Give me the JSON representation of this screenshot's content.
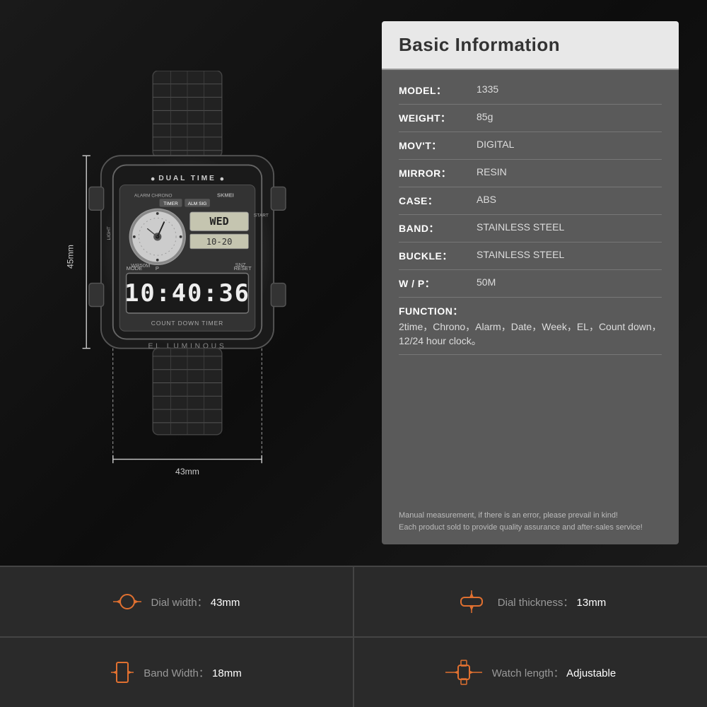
{
  "header": {
    "title": "Basic Information"
  },
  "specs_info": [
    {
      "key": "MODEL",
      "label": "MODEL：",
      "value": "1335"
    },
    {
      "key": "WEIGHT",
      "label": "WEIGHT：",
      "value": "85g"
    },
    {
      "key": "MOVT",
      "label": "MOV'T：",
      "value": "DIGITAL"
    },
    {
      "key": "MIRROR",
      "label": "MIRROR：",
      "value": "RESIN"
    },
    {
      "key": "CASE",
      "label": "CASE：",
      "value": "ABS"
    },
    {
      "key": "BAND",
      "label": "BAND：",
      "value": "STAINLESS STEEL"
    },
    {
      "key": "BUCKLE",
      "label": "BUCKLE：",
      "value": "STAINLESS STEEL"
    },
    {
      "key": "WP",
      "label": "W / P：",
      "value": "50M"
    }
  ],
  "function": {
    "label": "FUNCTION：",
    "value": "2time，Chrono，Alarm，Date，Week，EL，Count down，12/24 hour clock。"
  },
  "disclaimer": "Manual measurement, if there is an error, please prevail in kind!\nEach product sold to provide quality assurance and after-sales service!",
  "dimensions": {
    "height": "45mm",
    "width": "43mm"
  },
  "bottom_specs": [
    {
      "icon": "dial-width",
      "label": "Dial width：",
      "value": "43mm"
    },
    {
      "icon": "dial-thickness",
      "label": "Dial thickness：",
      "value": "13mm"
    },
    {
      "icon": "band-width",
      "label": "Band Width：",
      "value": "18mm"
    },
    {
      "icon": "watch-length",
      "label": "Watch length：",
      "value": "Adjustable"
    }
  ]
}
